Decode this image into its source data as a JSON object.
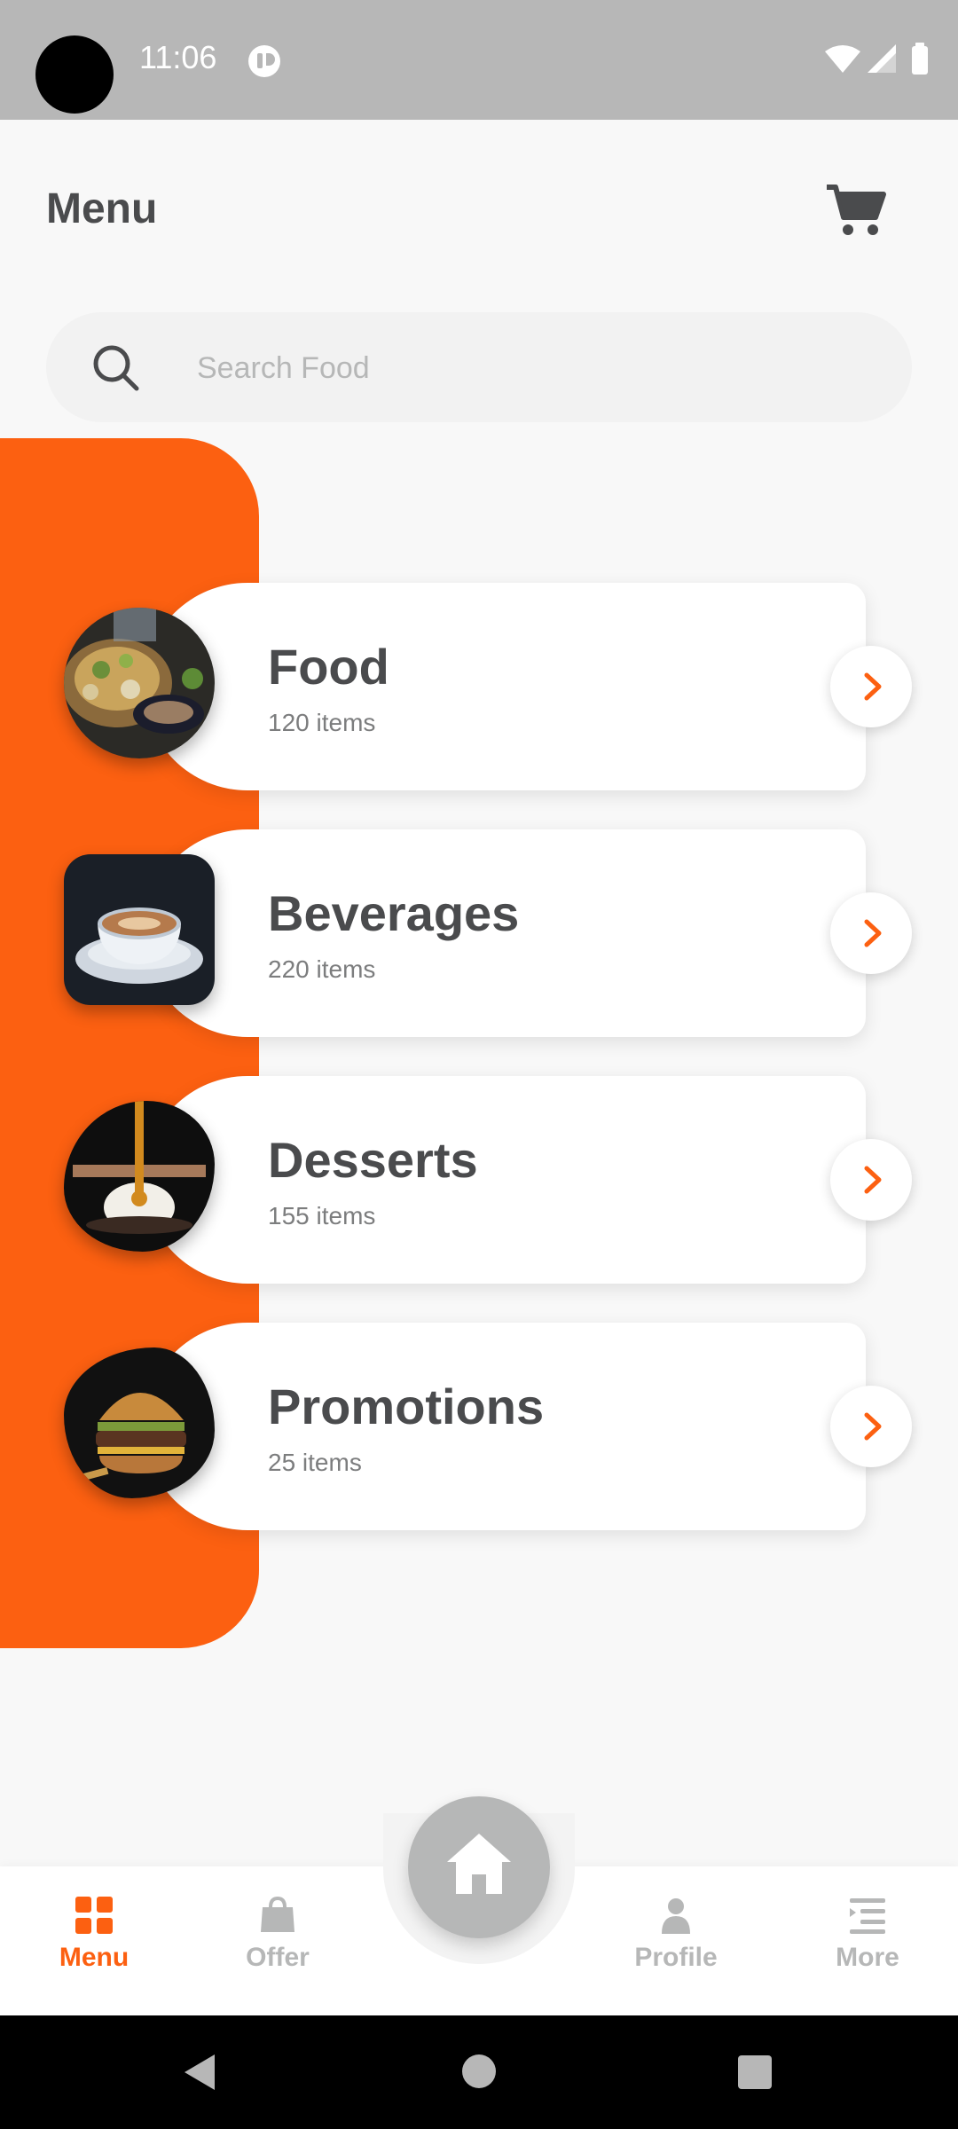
{
  "status_bar": {
    "time": "11:06"
  },
  "header": {
    "title": "Menu"
  },
  "search": {
    "placeholder": "Search Food"
  },
  "categories": [
    {
      "title": "Food",
      "count": "120 items"
    },
    {
      "title": "Beverages",
      "count": "220 items"
    },
    {
      "title": "Desserts",
      "count": "155 items"
    },
    {
      "title": "Promotions",
      "count": "25 items"
    }
  ],
  "bottom_nav": {
    "items": [
      {
        "label": "Menu",
        "icon": "grid-icon",
        "active": true
      },
      {
        "label": "Offer",
        "icon": "bag-icon",
        "active": false
      },
      {
        "label": "Profile",
        "icon": "person-icon",
        "active": false
      },
      {
        "label": "More",
        "icon": "list-icon",
        "active": false
      }
    ],
    "center_icon": "home-icon"
  },
  "colors": {
    "accent": "#fc6011",
    "text_primary": "#4a4b4d",
    "text_secondary": "#7c7d7e",
    "inactive": "#b6b7b7"
  }
}
